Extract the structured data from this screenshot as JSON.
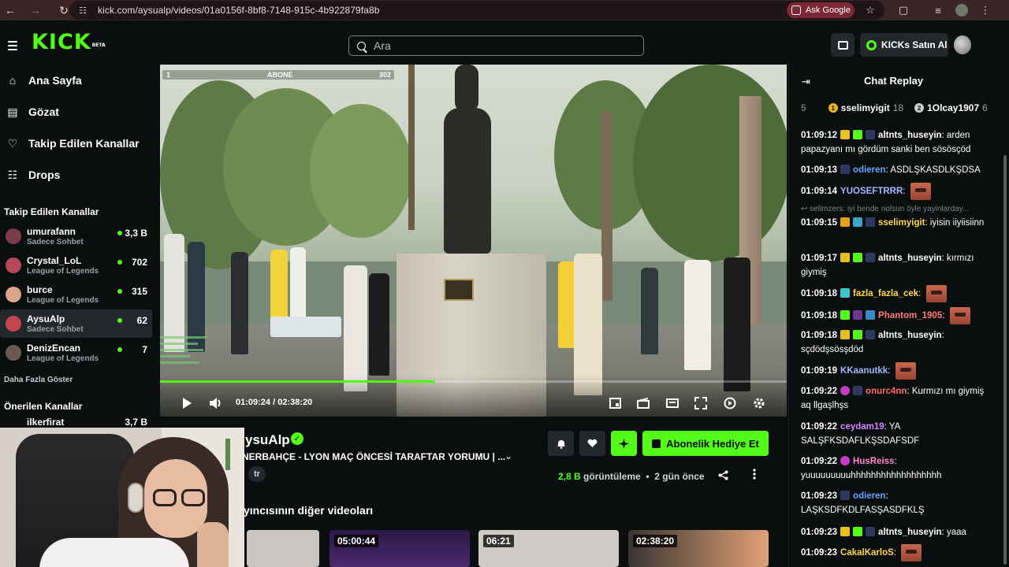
{
  "browser": {
    "url": "kick.com/aysualp/videos/01a0156f-8bf8-7148-915c-4b922879fa8b",
    "ask_google": "Ask Google"
  },
  "header": {
    "logo": "KICK",
    "logo_badge": "BETA",
    "search_placeholder": "Ara",
    "kicks_button": "KICKs Satın Al"
  },
  "sidebar": {
    "nav": [
      {
        "label": "Ana Sayfa",
        "icon": "home-icon"
      },
      {
        "label": "Gözat",
        "icon": "browse-icon"
      },
      {
        "label": "Takip Edilen Kanallar",
        "icon": "heart-icon"
      },
      {
        "label": "Drops",
        "icon": "drops-icon"
      }
    ],
    "followed_title": "Takip Edilen Kanallar",
    "followed": [
      {
        "name": "umurafann",
        "category": "Sadece Sohbet",
        "viewers": "3,3 B",
        "color": "#7a3b4a"
      },
      {
        "name": "Crystal_LoL",
        "category": "League of Legends",
        "viewers": "702",
        "color": "#b5485a"
      },
      {
        "name": "burce",
        "category": "League of Legends",
        "viewers": "315",
        "color": "#d9a68a"
      },
      {
        "name": "AysuAlp",
        "category": "Sadece Sohbet",
        "viewers": "62",
        "color": "#c34550"
      },
      {
        "name": "DenizEncan",
        "category": "League of Legends",
        "viewers": "7",
        "color": "#6b5a4f"
      }
    ],
    "show_more": "Daha Fazla Göster",
    "recommended_title": "Önerilen Kanallar",
    "recommended_first": {
      "name": "ilkerfirat",
      "viewers": "3,7 B"
    }
  },
  "video": {
    "overlay_left": "1",
    "overlay_center": "ABONE",
    "overlay_right": "302",
    "current_time": "01:09:24",
    "separator": "/",
    "duration": "02:38:20",
    "progress_fraction": 0.439
  },
  "channel": {
    "name": "AysuAlp",
    "name_visible": "ysuAlp",
    "title": "NERBAHÇE - LYON MAÇ ÖNCESİ TARAFTAR YORUMU | ...",
    "language": "tr",
    "gift_button": "Abonelik Hediye Et",
    "views_count": "2,8 B",
    "views_label": "görüntüleme",
    "bullet": "•",
    "age": "2 gün önce",
    "other_videos": "yıncısının diğer videoları",
    "thumbs": [
      {
        "duration": "",
        "color": "#c9c6c1"
      },
      {
        "duration": "05:00:44",
        "color": "#3a1e5a"
      },
      {
        "duration": "06:21",
        "color": "#cfcbc6"
      },
      {
        "duration": "02:38:20",
        "color": "#e0a276"
      }
    ]
  },
  "chat": {
    "title": "Chat Replay",
    "leader_prefix": "5",
    "leaders": [
      {
        "name": "sselimyigit",
        "count": "18",
        "badge": "1",
        "color": "#e8b322"
      },
      {
        "name": "1Olcay1907",
        "count": "6",
        "badge": "2",
        "color": "#c9cccd"
      }
    ],
    "reply_hint": "↩ selimzers: iyi bende nolsun öyle yayinlarday...",
    "messages": [
      {
        "time": "01:09:12",
        "user": "altnts_huseyin",
        "color": "#ffffff",
        "text": "arden papazyanı mı gördüm sanki ben sösösçöd"
      },
      {
        "time": "01:09:13",
        "user": "odieren",
        "color": "#6aa3ff",
        "text": "ASDLŞKASDLKŞDSA"
      },
      {
        "time": "01:09:14",
        "user": "YUOSEFTRRR",
        "color": "#9fb8ff",
        "text": ""
      },
      {
        "time": "01:09:15",
        "user": "sselimyigit",
        "color": "#ffd84a",
        "text": "iyisin iiyiisiinn"
      },
      {
        "time": "01:09:17",
        "user": "altnts_huseyin",
        "color": "#ffffff",
        "text": "kırmızı giymiş"
      },
      {
        "time": "01:09:18",
        "user": "fazla_fazla_cek",
        "color": "#ffd84a",
        "text": ""
      },
      {
        "time": "01:09:18",
        "user": "Phantom_1905",
        "color": "#ff7a7a",
        "text": ""
      },
      {
        "time": "01:09:18",
        "user": "altnts_huseyin",
        "color": "#ffffff",
        "text": "sçdödşsösşdöd"
      },
      {
        "time": "01:09:19",
        "user": "KKaanutkk",
        "color": "#9fb8ff",
        "text": ""
      },
      {
        "time": "01:09:22",
        "user": "onurc4nn",
        "color": "#ff6b6b",
        "text": "Kurmızı mı giymiş aq llgaşlhşs"
      },
      {
        "time": "01:09:22",
        "user": "ceydam19",
        "color": "#d884ff",
        "text": "YA SALŞFKSDAFLKŞSDAFSDF"
      },
      {
        "time": "01:09:22",
        "user": "HusReiss",
        "color": "#ff8ad1",
        "text": "yuuuuuuuuuhhhhhhhhhhhhhhhhhh"
      },
      {
        "time": "01:09:23",
        "user": "odieren",
        "color": "#6aa3ff",
        "text": "LAŞKSDFKDLFASŞASDFKLŞ"
      },
      {
        "time": "01:09:23",
        "user": "altnts_huseyin",
        "color": "#ffffff",
        "text": "yaaa"
      },
      {
        "time": "01:09:23",
        "user": "CakalKarloS",
        "color": "#ffd84a",
        "text": ""
      }
    ]
  },
  "colors": {
    "accent": "#53fc18",
    "bg": "#0b0e0f",
    "panel": "#24272c"
  }
}
